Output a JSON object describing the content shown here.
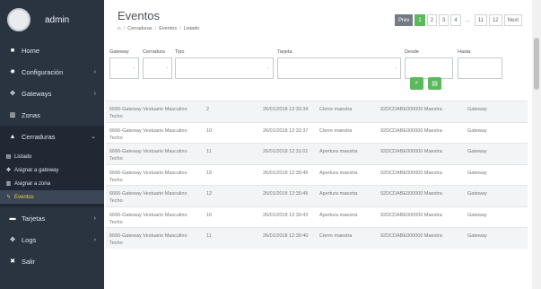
{
  "sidebar": {
    "username": "admin",
    "items": [
      {
        "label": "Home",
        "icon": "home-icon",
        "glyph": "■",
        "chevron": false
      },
      {
        "label": "Configuración",
        "icon": "gear-icon",
        "glyph": "✹",
        "chevron": true
      },
      {
        "label": "Gateways",
        "icon": "move-icon",
        "glyph": "✥",
        "chevron": true
      },
      {
        "label": "Zonas",
        "icon": "zone-icon",
        "glyph": "▥",
        "chevron": false
      },
      {
        "label": "Cerraduras",
        "icon": "lock-icon",
        "glyph": "▲",
        "chevron": true,
        "chevron_glyph": "⌄"
      }
    ],
    "submenu": [
      {
        "label": "Listado",
        "icon": "list-icon",
        "glyph": "▤"
      },
      {
        "label": "Asignar a gateway",
        "icon": "move-icon",
        "glyph": "✥"
      },
      {
        "label": "Asignar a zona",
        "icon": "zone-icon",
        "glyph": "▥"
      },
      {
        "label": "Eventos",
        "icon": "flash-icon",
        "glyph": "ϟ"
      }
    ],
    "items_after": [
      {
        "label": "Tarjetas",
        "icon": "card-icon",
        "glyph": "▬",
        "chevron": true
      },
      {
        "label": "Logs",
        "icon": "move-icon",
        "glyph": "✥",
        "chevron": true
      },
      {
        "label": "Salir",
        "icon": "close-icon",
        "glyph": "✖",
        "chevron": false
      }
    ]
  },
  "header": {
    "title": "Eventos",
    "breadcrumb": [
      "Cerraduras",
      "Eventos",
      "Listado"
    ]
  },
  "pagination": {
    "prev": "Prev",
    "pages": [
      "1",
      "2",
      "3",
      "4"
    ],
    "dots": "...",
    "last_pages": [
      "11",
      "12"
    ],
    "next": "Next"
  },
  "filters": {
    "gateway": "Gateway",
    "cerradura": "Cerradura",
    "tipo": "Tipo",
    "tarjeta": "Tarjeta",
    "desde": "Desde",
    "hasta": "Hasta",
    "select_dash": "-"
  },
  "table": {
    "rows": [
      [
        "6666-Gateway Vestuario Masculino Techo",
        "2",
        "26/01/2018 12:33:34",
        "Cierre maestra",
        "92DCDABE000000 Maestra",
        "Gateway"
      ],
      [
        "6666-Gateway Vestuario Masculino Techo",
        "10",
        "26/01/2018 12:32:37",
        "Cierre maestra",
        "92DCDABE000000 Maestra",
        "Gateway"
      ],
      [
        "6666-Gateway Vestuario Masculino Techo",
        "11",
        "26/01/2018 12:31:01",
        "Apertura maestra",
        "92DCDABE000000 Maestra",
        "Gateway"
      ],
      [
        "6666-Gateway Vestuario Masculino Techo",
        "19",
        "26/01/2018 12:30:45",
        "Apertura maestra",
        "92DCDABE000000 Maestra",
        "Gateway"
      ],
      [
        "6666-Gateway Vestuario Masculino Techo",
        "12",
        "26/01/2018 12:30:45",
        "Apertura maestra",
        "92DCDABE000000 Maestra",
        "Gateway"
      ],
      [
        "6666-Gateway Vestuario Masculino Techo",
        "16",
        "26/01/2018 12:30:43",
        "Apertura maestra",
        "92DCDABE000000 Maestra",
        "Gateway"
      ],
      [
        "6666-Gateway Vestuario Masculino Techo",
        "11",
        "26/01/2018 12:30:40",
        "Cierre maestra",
        "92DCDABE000000 Maestra",
        "Gateway"
      ]
    ]
  },
  "colors": {
    "sidebar_bg": "#2a3441",
    "accent_green": "#5cb85c",
    "active_submenu_text": "#f4d03f"
  }
}
